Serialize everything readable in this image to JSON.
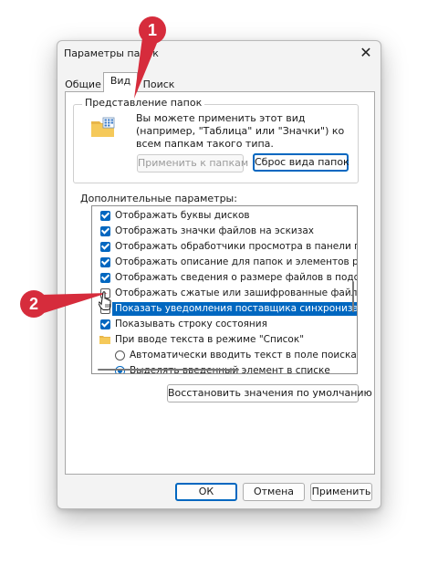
{
  "window": {
    "title": "Параметры папок",
    "close_glyph": "✕"
  },
  "tabs": [
    {
      "label": "Общие",
      "active": false
    },
    {
      "label": "Вид",
      "active": true
    },
    {
      "label": "Поиск",
      "active": false
    }
  ],
  "folder_views": {
    "group_label": "Представление папок",
    "icon": "folder-icon",
    "description": "Вы можете применить этот вид (например, \"Таблица\" или \"Значки\") ко всем папкам такого типа.",
    "apply_button": "Применить к папкам",
    "reset_button": "Сброс вида папок"
  },
  "advanced": {
    "label": "Дополнительные параметры:",
    "items": [
      {
        "type": "checkbox",
        "checked": true,
        "label": "Отображать буквы дисков"
      },
      {
        "type": "checkbox",
        "checked": true,
        "label": "Отображать значки файлов на эскизах"
      },
      {
        "type": "checkbox",
        "checked": true,
        "label": "Отображать обработчики просмотра в панели просм"
      },
      {
        "type": "checkbox",
        "checked": true,
        "label": "Отображать описание для папок и элементов рабоче"
      },
      {
        "type": "checkbox",
        "checked": true,
        "label": "Отображать сведения о размере файлов в подсказк"
      },
      {
        "type": "checkbox",
        "checked": false,
        "label": "Отображать сжатые или зашифрованные файлы NTI"
      },
      {
        "type": "checkbox",
        "checked": false,
        "selected": true,
        "label": "Показать уведомления поставщика синхронизации"
      },
      {
        "type": "checkbox",
        "checked": true,
        "label": "Показывать строку состояния"
      },
      {
        "type": "folder",
        "label": "При вводе текста в режиме \"Список\""
      },
      {
        "type": "radio",
        "checked": false,
        "label": "Автоматически вводить текст в поле поиска"
      },
      {
        "type": "radio",
        "checked": true,
        "label": "Выделять введенный элемент в списке"
      }
    ]
  },
  "restore_defaults_button": "Восстановить значения по умолчанию",
  "footer": {
    "ok": "ОК",
    "cancel": "Отмена",
    "apply": "Применить"
  },
  "annotations": [
    {
      "number": "1",
      "color": "#d62c3c"
    },
    {
      "number": "2",
      "color": "#d62c3c"
    }
  ],
  "colors": {
    "accent": "#0067c0",
    "annotation": "#d62c3c",
    "dialog_bg": "#f3f3f3"
  }
}
